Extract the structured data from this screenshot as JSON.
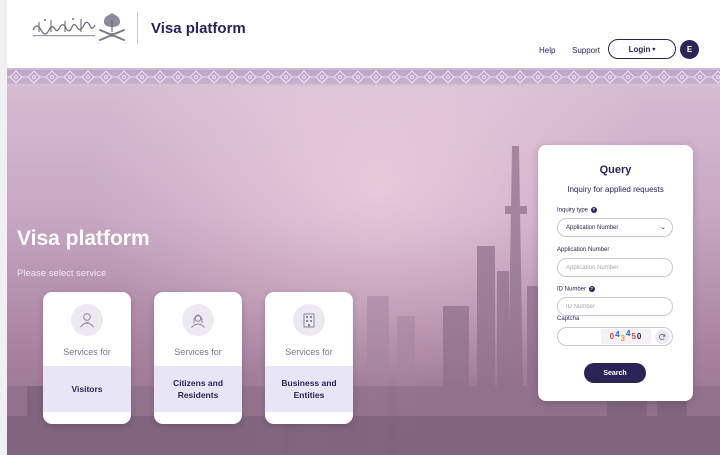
{
  "header": {
    "logo_alt": "وزارة الخارجية",
    "title": "Visa platform",
    "nav": {
      "help": "Help",
      "support": "Support"
    },
    "login_label": "Login",
    "language_label": "E"
  },
  "hero": {
    "title": "Visa platform",
    "subtitle": "Please select service",
    "services": [
      {
        "prefix": "Services for",
        "name": "Visitors",
        "icon": "visitor-person-icon"
      },
      {
        "prefix": "Services for",
        "name": "Citizens and Residents",
        "icon": "citizen-person-icon"
      },
      {
        "prefix": "Services for",
        "name": "Business and Entities",
        "icon": "building-icon"
      }
    ]
  },
  "query": {
    "title": "Query",
    "subtitle": "Inquiry for applied requests",
    "inquiry_type_label": "Inquiry type",
    "inquiry_type_value": "Application Number",
    "application_number_label": "Application Number",
    "application_number_placeholder": "Application Number",
    "id_number_label": "ID Number",
    "id_number_placeholder": "ID Number",
    "captcha_label": "Captcha",
    "captcha_chars": [
      "0",
      "4",
      "3",
      "4",
      "5",
      "0"
    ],
    "search_label": "Search"
  },
  "colors": {
    "primary": "#2b2457",
    "card_band": "#e8e6f6"
  }
}
